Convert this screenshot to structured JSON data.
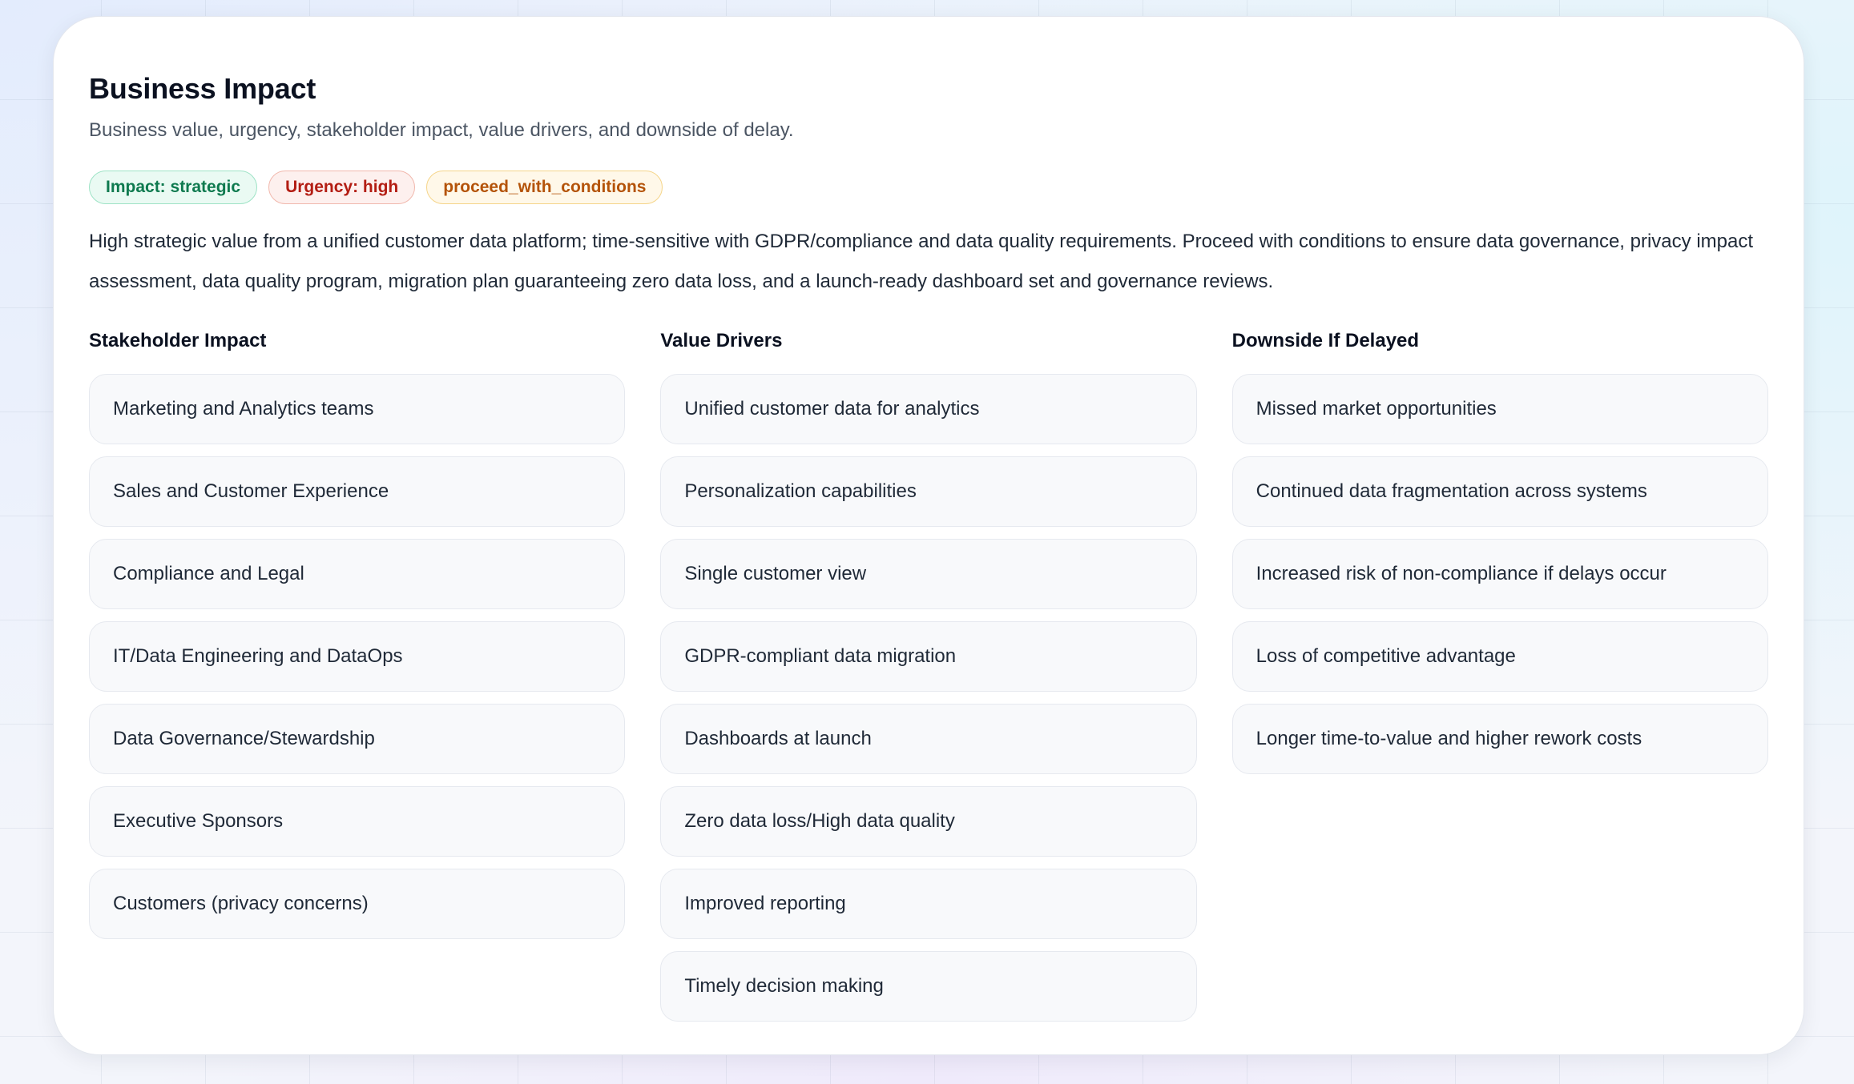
{
  "header": {
    "title": "Business Impact",
    "subtitle": "Business value, urgency, stakeholder impact, value drivers, and downside of delay."
  },
  "badges": [
    {
      "label": "Impact: strategic",
      "color": "#0f7a4f"
    },
    {
      "label": "Urgency: high",
      "color": "#b31d13"
    },
    {
      "label": "proceed_with_conditions",
      "color": "#b45309"
    }
  ],
  "summary": "High strategic value from a unified customer data platform; time-sensitive with GDPR/compliance and data quality requirements. Proceed with conditions to ensure data governance, privacy impact assessment, data quality program, migration plan guaranteeing zero data loss, and a launch-ready dashboard set and governance reviews.",
  "columns": [
    {
      "title": "Stakeholder Impact",
      "items": [
        "Marketing and Analytics teams",
        "Sales and Customer Experience",
        "Compliance and Legal",
        "IT/Data Engineering and DataOps",
        "Data Governance/Stewardship",
        "Executive Sponsors",
        "Customers (privacy concerns)"
      ]
    },
    {
      "title": "Value Drivers",
      "items": [
        "Unified customer data for analytics",
        "Personalization capabilities",
        "Single customer view",
        "GDPR-compliant data migration",
        "Dashboards at launch",
        "Zero data loss/High data quality",
        "Improved reporting",
        "Timely decision making"
      ]
    },
    {
      "title": "Downside If Delayed",
      "items": [
        "Missed market opportunities",
        "Continued data fragmentation across systems",
        "Increased risk of non-compliance if delays occur",
        "Loss of competitive advantage",
        "Longer time-to-value and higher rework costs"
      ]
    }
  ]
}
